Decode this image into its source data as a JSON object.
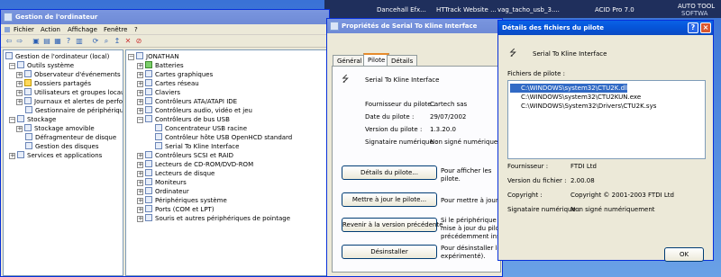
{
  "taskbar": {
    "items": [
      "Dancehall Efx...",
      "HTTrack Website ...",
      "vag_tacho_usb_3....",
      "ACID Pro 7.0",
      "AUTO TOOL",
      "SOFTWA"
    ]
  },
  "devmgr": {
    "title": "Gestion de l'ordinateur",
    "menu": [
      "Fichier",
      "Action",
      "Affichage",
      "Fenêtre",
      "?"
    ],
    "tree": [
      {
        "label": "Gestion de l'ordinateur (local)",
        "level": 0
      },
      {
        "label": "Outils système",
        "level": 1
      },
      {
        "label": "Observateur d'événements",
        "level": 2
      },
      {
        "label": "Dossiers partagés",
        "level": 2
      },
      {
        "label": "Utilisateurs et groupes locaux",
        "level": 2
      },
      {
        "label": "Journaux et alertes de perform",
        "level": 2
      },
      {
        "label": "Gestionnaire de périphérique",
        "level": 2
      },
      {
        "label": "Stockage",
        "level": 1
      },
      {
        "label": "Stockage amovible",
        "level": 2
      },
      {
        "label": "Défragmenteur de disque",
        "level": 2
      },
      {
        "label": "Gestion des disques",
        "level": 2
      },
      {
        "label": "Services et applications",
        "level": 1
      }
    ],
    "devices": [
      {
        "label": "JONATHAN",
        "level": 0
      },
      {
        "label": "Batteries",
        "level": 1
      },
      {
        "label": "Cartes graphiques",
        "level": 1
      },
      {
        "label": "Cartes réseau",
        "level": 1
      },
      {
        "label": "Claviers",
        "level": 1
      },
      {
        "label": "Contrôleurs ATA/ATAPI IDE",
        "level": 1
      },
      {
        "label": "Contrôleurs audio, vidéo et jeu",
        "level": 1
      },
      {
        "label": "Contrôleurs de bus USB",
        "level": 1
      },
      {
        "label": "Concentrateur USB racine",
        "level": 2
      },
      {
        "label": "Contrôleur hôte USB OpenHCD standard",
        "level": 2
      },
      {
        "label": "Serial To Kline Interface",
        "level": 2
      },
      {
        "label": "Contrôleurs SCSI et RAID",
        "level": 1
      },
      {
        "label": "Lecteurs de CD-ROM/DVD-ROM",
        "level": 1
      },
      {
        "label": "Lecteurs de disque",
        "level": 1
      },
      {
        "label": "Moniteurs",
        "level": 1
      },
      {
        "label": "Ordinateur",
        "level": 1
      },
      {
        "label": "Périphériques système",
        "level": 1
      },
      {
        "label": "Ports (COM et LPT)",
        "level": 1
      },
      {
        "label": "Souris et autres périphériques de pointage",
        "level": 1
      }
    ]
  },
  "props": {
    "title": "Propriétés de Serial To Kline Interface",
    "tabs": [
      "Général",
      "Pilote",
      "Détails"
    ],
    "device_name": "Serial To Kline Interface",
    "fields": [
      {
        "label": "Fournisseur du pilote :",
        "value": "Cartech sas"
      },
      {
        "label": "Date du pilote :",
        "value": "29/07/2002"
      },
      {
        "label": "Version du pilote :",
        "value": "1.3.20.0"
      },
      {
        "label": "Signataire numérique :",
        "value": "Non signé numériquer"
      }
    ],
    "buttons": [
      {
        "label": "Détails du pilote...",
        "desc": [
          "Pour afficher les",
          "pilote."
        ]
      },
      {
        "label": "Mettre à jour le pilote...",
        "desc": [
          "Pour mettre à jour le p"
        ]
      },
      {
        "label": "Revenir à la version précédente",
        "desc": [
          "Si le périphérique ne f",
          "mise à jour du pilote,",
          "précédemment installé"
        ]
      },
      {
        "label": "Désinstaller",
        "desc": [
          "Pour désinstaller le pil",
          "expérimenté)."
        ]
      }
    ]
  },
  "details": {
    "title": "Détails des fichiers du pilote",
    "device_name": "Serial To Kline Interface",
    "files_label": "Fichiers de pilote :",
    "files": [
      "C:\\WINDOWS\\system32\\CTU2K.dll",
      "C:\\WINDOWS\\system32\\CTU2KUN.exe",
      "C:\\WINDOWS\\System32\\Drivers\\CTU2K.sys"
    ],
    "info": [
      {
        "label": "Fournisseur :",
        "value": "FTDI Ltd"
      },
      {
        "label": "Version du fichier :",
        "value": "2.00.08"
      },
      {
        "label": "Copyright :",
        "value": "Copyright © 2001-2003 FTDI Ltd"
      },
      {
        "label": "Signataire numérique :",
        "value": "Non signé numériquement"
      }
    ],
    "ok_label": "OK"
  },
  "colors": {
    "title_active": "#0554d8",
    "selection": "#316ac5",
    "window_bg": "#ece9d8"
  }
}
